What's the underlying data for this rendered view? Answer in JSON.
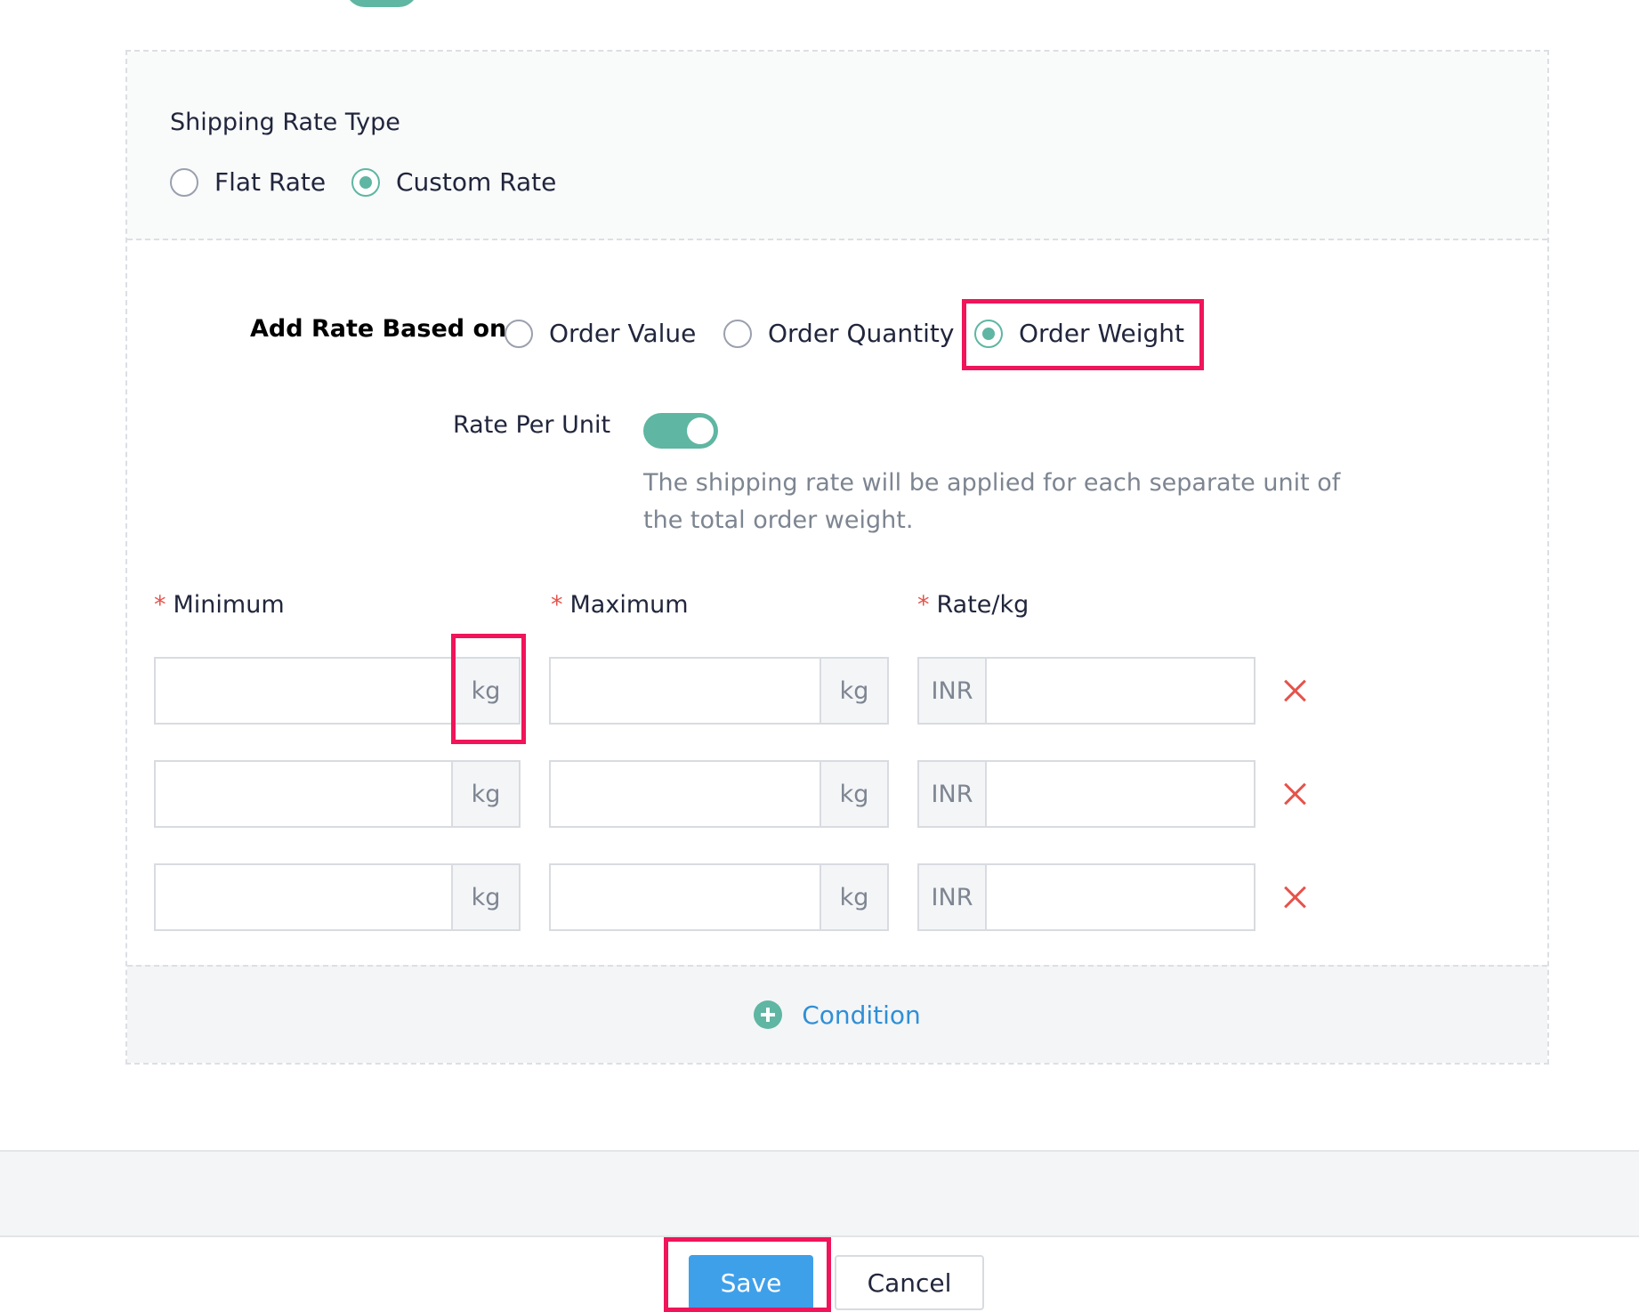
{
  "shipping_rate_type": {
    "title": "Shipping Rate Type",
    "options": [
      {
        "label": "Flat Rate",
        "selected": false
      },
      {
        "label": "Custom Rate",
        "selected": true
      }
    ]
  },
  "rate_based_on": {
    "label": "Add Rate Based on",
    "options": [
      {
        "label": "Order Value",
        "selected": false
      },
      {
        "label": "Order Quantity",
        "selected": false
      },
      {
        "label": "Order Weight",
        "selected": true
      }
    ]
  },
  "rate_per_unit": {
    "label": "Rate Per Unit",
    "enabled": true,
    "helper_text": "The shipping rate will be applied for each separate unit of the total order weight."
  },
  "columns": {
    "required_marker": "*",
    "minimum": "Minimum",
    "maximum": "Maximum",
    "rate": "Rate/kg"
  },
  "rows": [
    {
      "min_unit": "kg",
      "max_unit": "kg",
      "currency": "INR",
      "min_value": "",
      "max_value": "",
      "rate_value": ""
    },
    {
      "min_unit": "kg",
      "max_unit": "kg",
      "currency": "INR",
      "min_value": "",
      "max_value": "",
      "rate_value": ""
    },
    {
      "min_unit": "kg",
      "max_unit": "kg",
      "currency": "INR",
      "min_value": "",
      "max_value": "",
      "rate_value": ""
    }
  ],
  "add_condition_label": "Condition",
  "footer": {
    "save_label": "Save",
    "cancel_label": "Cancel"
  },
  "colors": {
    "accent": "#5fb6a2",
    "link": "#2f8fd6",
    "primary_button": "#3fa0ea",
    "delete": "#e5534b",
    "highlight": "#f0145a"
  }
}
